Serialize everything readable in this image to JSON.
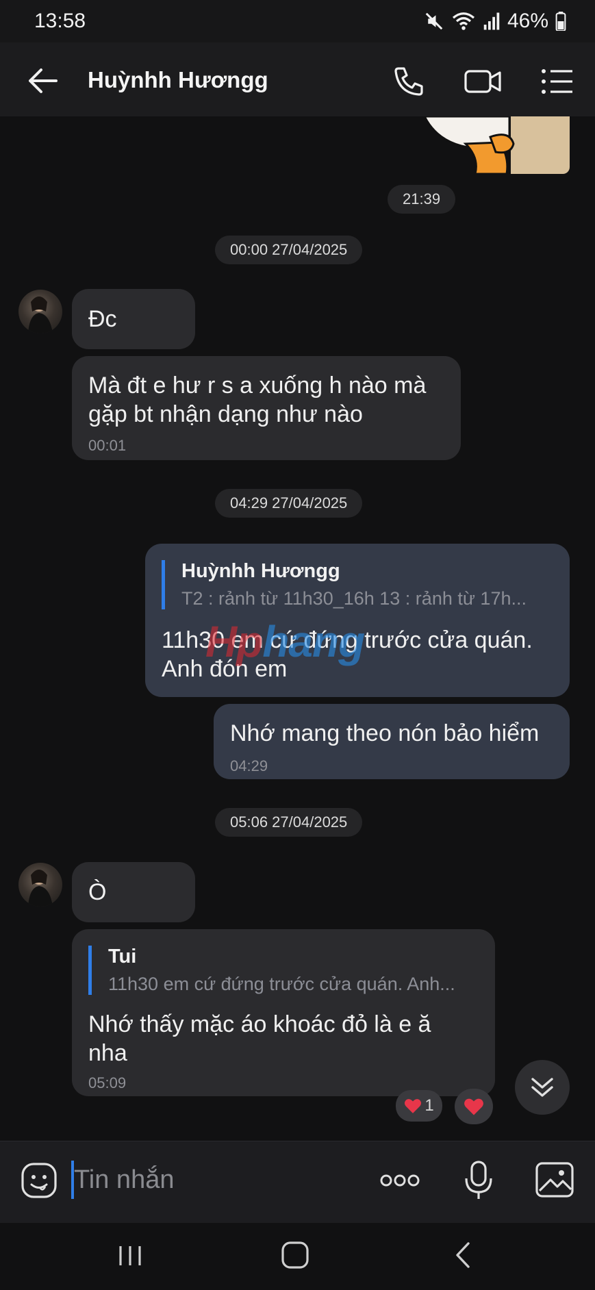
{
  "status_bar": {
    "time": "13:58",
    "battery": "46%"
  },
  "header": {
    "contact_name": "Huỳnhh Hươngg"
  },
  "messages": [
    {
      "time_pill": "21:39"
    },
    {
      "date_pill": "00:00 27/04/2025"
    },
    {
      "text": "Đc"
    },
    {
      "text_line1": "Mà đt e hư r s a xuống h nào mà",
      "text_line2": "gặp bt nhận dạng như nào",
      "time": "00:01"
    },
    {
      "date_pill": "04:29 27/04/2025"
    },
    {
      "reply_name": "Huỳnhh Hươngg",
      "reply_snippet": "T2 : rảnh từ 11h30_16h  13 : rảnh từ 17h...",
      "text_line1": "11h30 em cứ đứng trước cửa quán.",
      "text_line2": "Anh đón em"
    },
    {
      "text": "Nhớ mang theo nón bảo hiểm",
      "time": "04:29"
    },
    {
      "date_pill": "05:06 27/04/2025"
    },
    {
      "text": "Ò"
    },
    {
      "reply_name": "Tui",
      "reply_snippet": "11h30 em cứ đứng trước cửa quán. Anh...",
      "text_line1": "Nhớ thấy mặc áo khoác đỏ là e ă",
      "text_line2": "nha",
      "time": "05:09",
      "reaction_count": "1"
    }
  ],
  "watermark": {
    "part1": "Hp",
    "part2": "hang"
  },
  "input": {
    "placeholder": "Tin nhắn"
  },
  "colors": {
    "accent": "#2f7ee8",
    "background": "#111112",
    "bubble_other": "#2b2b2e",
    "bubble_me": "#343a48",
    "heart": "#e8364a"
  }
}
